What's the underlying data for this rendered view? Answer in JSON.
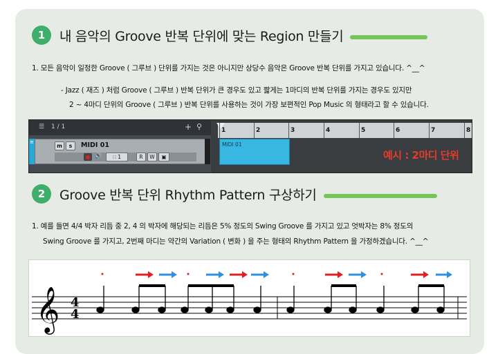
{
  "section1": {
    "number": "1",
    "title": "내 음악의 Groove 반복 단위에 맞는 Region 만들기",
    "para1": "1. 모든 음악이 일정한 Groove ( 그루브 ) 단위를 가지는 것은 아니지만 상당수 음악은 Groove 반복 단위를 가지고 있습니다. ^__^",
    "para2a": "- Jazz ( 재즈 ) 처럼 Groove ( 그루브 ) 반복 단위가 큰 경우도 있고 짧게는 1마디의 반복 단위를 가지는 경우도 있지만",
    "para2b": "2 ~ 4마디 단위의 Groove ( 그루브 ) 반복 단위를 사용하는 것이 가장 보편적인 Pop Music 의 형태라고 할 수 있습니다."
  },
  "daw": {
    "header_count": "1 / 1",
    "track_name": "MIDI 01",
    "btn_m": "m",
    "btn_s": "s",
    "btn_num": "1",
    "btn_r": "R",
    "btn_w": "W",
    "clip_name": "MIDI 01",
    "ruler": [
      "1",
      "2",
      "3",
      "4",
      "5",
      "6",
      "7",
      "8"
    ],
    "example_label": "예시 : 2마디 단위",
    "accent_clip": "#39b7e3",
    "accent_example": "#e43c2c"
  },
  "section2": {
    "number": "2",
    "title": "Groove 반복 단위 Rhythm Pattern 구상하기",
    "para1": "1. 예를 들면 4/4 박자 리듬 중 2, 4 의 박자에 해당되는 리듬은 5% 정도의 Swing Groove 를 가지고 있고 엇박자는 8% 정도의",
    "para2": "Swing Groove 를 가지고, 2번째 마디는 약간의 Variation ( 변화 ) 을 주는 형태의 Rhythm Pattern 을 가정하겠습니다. ^__^"
  },
  "score": {
    "time_sig_top": "4",
    "time_sig_bottom": "4",
    "markers": [
      "dot",
      "red",
      "blue",
      "dot",
      "blue",
      "red",
      "blue",
      "dot",
      "red",
      "blue",
      "dot",
      "red",
      "blue"
    ]
  }
}
